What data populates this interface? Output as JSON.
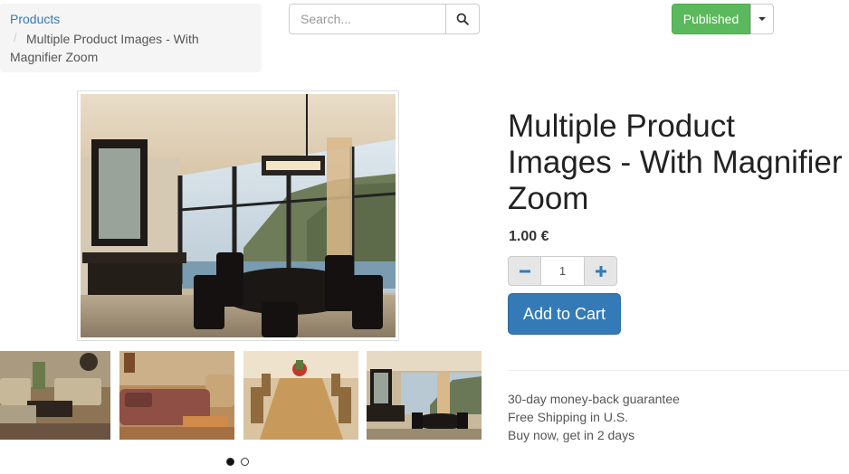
{
  "breadcrumb": {
    "root_label": "Products",
    "separator": "/",
    "current_label": "Multiple Product Images - With Magnifier Zoom"
  },
  "search": {
    "placeholder": "Search...",
    "value": ""
  },
  "publish": {
    "label": "Published",
    "color": "#5cb85c"
  },
  "product": {
    "title": "Multiple Product Images - With Magnifier Zoom",
    "price": "1.00 €",
    "quantity": "1",
    "add_to_cart_label": "Add to Cart",
    "accent_color": "#337ab7"
  },
  "gallery": {
    "thumbnails": [
      "living-room-photo",
      "sofa-room-photo",
      "dining-table-photo",
      "dining-room-view-photo"
    ],
    "pager": {
      "total": 2,
      "active": 1
    }
  },
  "benefits": [
    "30-day money-back guarantee",
    "Free Shipping in U.S.",
    "Buy now, get in 2 days"
  ]
}
